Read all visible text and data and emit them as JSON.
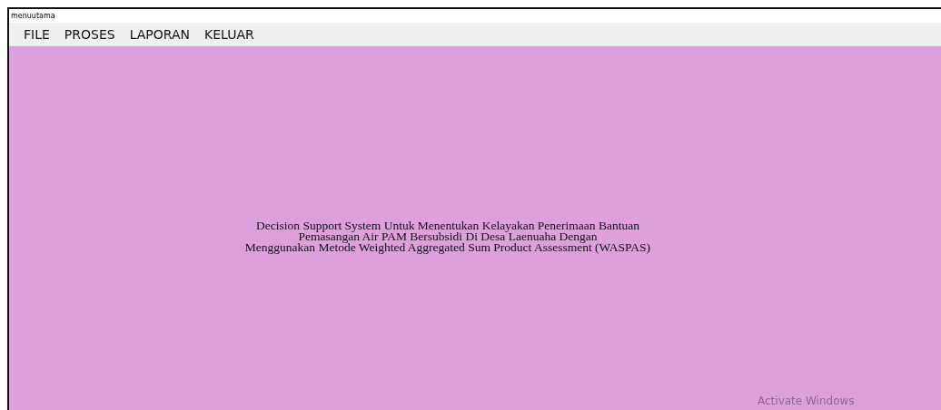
{
  "window": {
    "title": "menuutama"
  },
  "menu": [
    {
      "label": "FILE"
    },
    {
      "label": "PROSES"
    },
    {
      "label": "LAPORAN"
    },
    {
      "label": "KELUAR"
    }
  ],
  "heading": [
    "Decision Support System Untuk Menentukan Kelayakan Penerimaan Bantuan",
    "Pemasangan Air PAM Bersubsidi Di Desa Laenuaha Dengan",
    "Menggunakan Metode Weighted Aggregated Sum Product Assessment (WASPAS)"
  ],
  "activation_notice": "Activate Windows"
}
